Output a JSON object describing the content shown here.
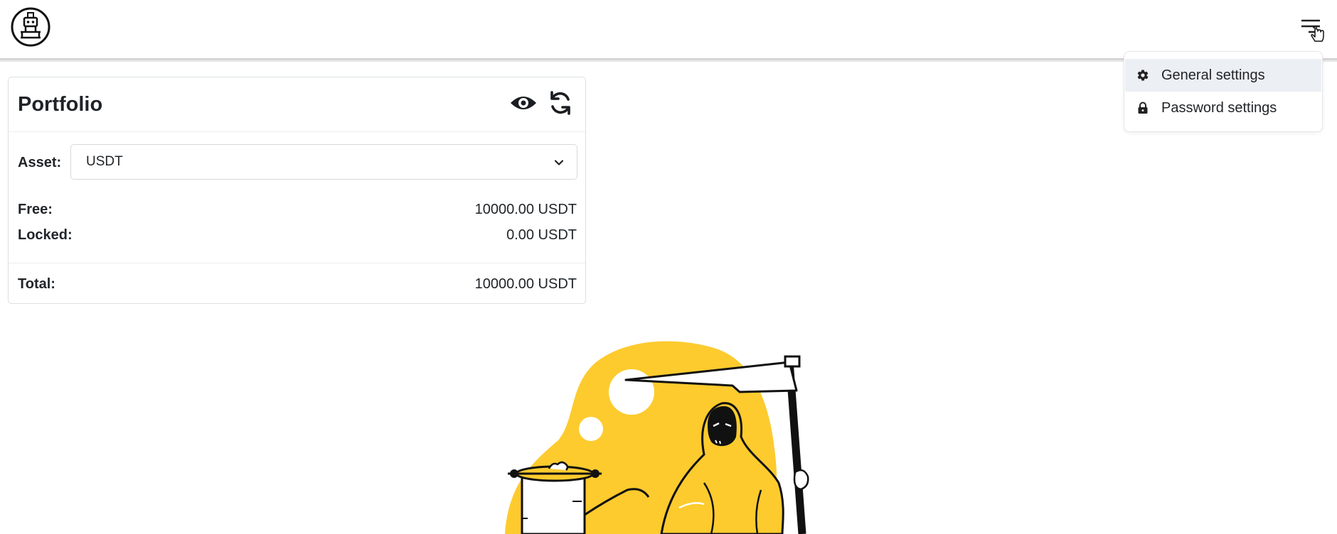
{
  "header": {
    "logo_icon": "robot-icon",
    "menu_icon": "menu-lines-icon"
  },
  "dropdown": {
    "items": [
      {
        "label": "General settings",
        "icon": "gear-icon"
      },
      {
        "label": "Password settings",
        "icon": "lock-icon"
      }
    ]
  },
  "portfolio": {
    "title": "Portfolio",
    "asset_label": "Asset:",
    "asset_value": "USDT",
    "rows": [
      {
        "label": "Free:",
        "value": "10000.00 USDT"
      },
      {
        "label": "Locked:",
        "value": "0.00 USDT"
      }
    ],
    "total": {
      "label": "Total:",
      "value": "10000.00 USDT"
    }
  },
  "colors": {
    "illustration_yellow": "#fdcb2e",
    "text": "#212529",
    "dropdown_hover": "#eceff3"
  }
}
